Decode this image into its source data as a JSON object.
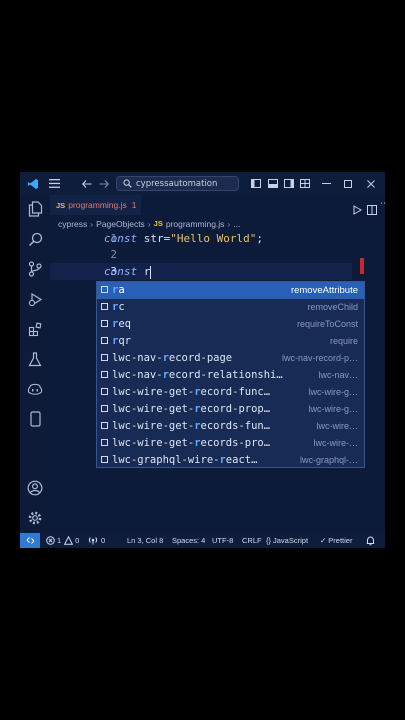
{
  "titlebar": {
    "search_text": "cypressautomation"
  },
  "tab": {
    "badge": "JS",
    "label": "programming.js",
    "count": "1"
  },
  "breadcrumb": {
    "folder1": "cypress",
    "folder2": "PageObjects",
    "badge": "JS",
    "file": "programming.js",
    "more": "..."
  },
  "editor": {
    "lines": [
      {
        "number": "1",
        "kw": "const",
        "text": " str=",
        "str": "\"Hello World\"",
        "end": ";"
      },
      {
        "number": "2"
      },
      {
        "number": "3",
        "kw": "const",
        "text": " r"
      }
    ]
  },
  "suggestions": [
    {
      "match": "r",
      "rest": "a",
      "detail": "removeAttribute"
    },
    {
      "match": "r",
      "rest": "c",
      "detail": "removeChild"
    },
    {
      "match": "r",
      "rest": "eq",
      "detail": "requireToConst"
    },
    {
      "match": "r",
      "rest": "qr",
      "detail": "require"
    },
    {
      "pre": "lwc-nav-",
      "match": "r",
      "rest": "ecord-page",
      "detail": "lwc-nav-record-p…"
    },
    {
      "pre": "lwc-nav-",
      "match": "r",
      "rest": "ecord-relationshi…",
      "detail": "lwc-nav…"
    },
    {
      "pre": "lwc-wire-get-",
      "match": "r",
      "rest": "ecord-func…",
      "detail": "lwc-wire-g…"
    },
    {
      "pre": "lwc-wire-get-",
      "match": "r",
      "rest": "ecord-prop…",
      "detail": "lwc-wire-g…"
    },
    {
      "pre": "lwc-wire-get-",
      "match": "r",
      "rest": "ecords-fun…",
      "detail": "lwc-wire…"
    },
    {
      "pre": "lwc-wire-get-",
      "match": "r",
      "rest": "ecords-pro…",
      "detail": "lwc-wire-…"
    },
    {
      "pre": "lwc-graphql-wire-",
      "match": "r",
      "rest": "eact…",
      "detail": "lwc-graphql-…"
    }
  ],
  "statusbar": {
    "errors": "1",
    "warnings": "0",
    "ports": "0",
    "position": "Ln 3, Col 8",
    "spaces": "Spaces: 4",
    "encoding": "UTF-8",
    "eol": "CRLF",
    "language": "JavaScript",
    "formatter": "Prettier"
  },
  "colors": {
    "background": "#0d1b3a",
    "accent": "#2f7bd4",
    "selection": "#2a5fb8",
    "string": "#e7c06a",
    "keyword": "#8fb1ff"
  }
}
